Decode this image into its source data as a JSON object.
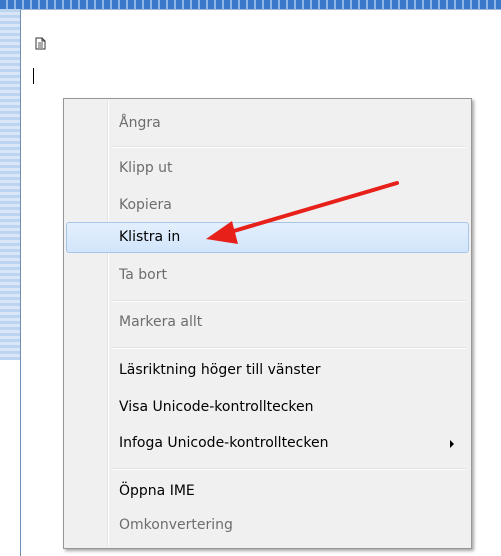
{
  "context_menu": {
    "items": [
      {
        "label": "Ångra",
        "state": "disabled"
      },
      {
        "label": "Klipp ut",
        "state": "disabled"
      },
      {
        "label": "Kopiera",
        "state": "disabled"
      },
      {
        "label": "Klistra in",
        "state": "highlighted"
      },
      {
        "label": "Ta bort",
        "state": "disabled"
      },
      {
        "label": "Markera allt",
        "state": "disabled"
      },
      {
        "label": "Läsriktning höger till vänster",
        "state": "enabled"
      },
      {
        "label": "Visa Unicode-kontrolltecken",
        "state": "enabled"
      },
      {
        "label": "Infoga Unicode-kontrolltecken",
        "state": "enabled",
        "submenu": true
      },
      {
        "label": "Öppna IME",
        "state": "enabled"
      },
      {
        "label": "Omkonvertering",
        "state": "disabled"
      }
    ]
  },
  "icons": {
    "document": "document-icon",
    "submenu": "submenu-arrow-icon",
    "annotation": "red-arrow-annotation"
  },
  "colors": {
    "annotation_arrow": "#e8201a",
    "highlight_fill": "#d9e9fb",
    "highlight_border": "#a7c4e9",
    "disabled_text": "#6d6d6d",
    "window_frame": "#3a78c9"
  }
}
